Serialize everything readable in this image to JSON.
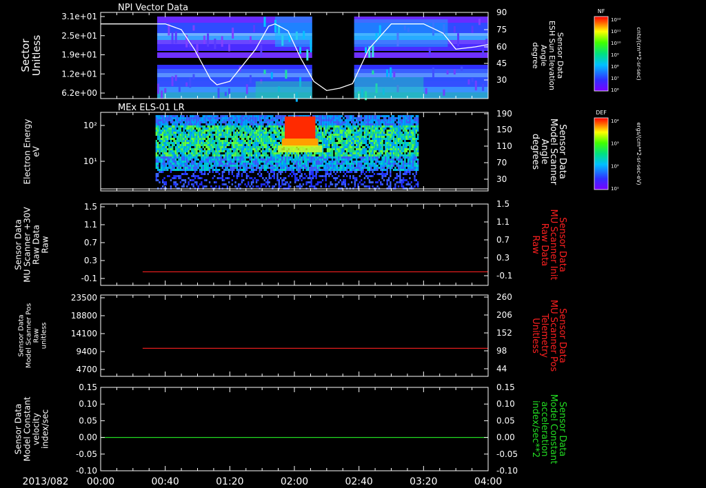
{
  "time_axis": {
    "date": "2013/082",
    "ticks": [
      "00:00",
      "00:40",
      "01:20",
      "02:00",
      "02:40",
      "03:20",
      "04:00"
    ],
    "range_minutes": [
      0,
      240
    ]
  },
  "panels": [
    {
      "id": "npi",
      "title": "NPI Vector Data",
      "left_axis_label": [
        "Sector",
        "Unitless"
      ],
      "left_ticks": [
        "3.1e+01",
        "2.5e+01",
        "1.9e+01",
        "1.2e+01",
        "6.2e+00"
      ],
      "right_axis_label": [
        "Sensor Data",
        "ESH Sun Elevation",
        "Angle",
        "degree"
      ],
      "right_ticks": [
        "90",
        "75",
        "60",
        "45",
        "30"
      ],
      "colorbar": {
        "title": "NF",
        "unit": "cnts/(cm**2-sr-sec)",
        "labels": [
          "10¹²",
          "10¹¹",
          "10¹⁰",
          "10⁹",
          "10⁸",
          "10⁷",
          "10⁶"
        ]
      }
    },
    {
      "id": "els",
      "title": "MEx ELS-01 LR",
      "left_axis_label": [
        "Electron Energy",
        "eV"
      ],
      "left_ticks": [
        "10²",
        "10¹"
      ],
      "right_axis_label": [
        "Sensor Data",
        "Model Scanner",
        "Angle",
        "degrees"
      ],
      "right_ticks": [
        "190",
        "150",
        "110",
        "70",
        "30"
      ],
      "colorbar": {
        "title": "DEF",
        "unit": "ergs/(cm**2-sr-sec-eV)",
        "labels": [
          "10⁴",
          "10³",
          "10²",
          "10¹"
        ]
      }
    },
    {
      "id": "scanner_raw",
      "left_axis_label": [
        "Sensor Data",
        "MU Scanner +30V",
        "Raw Data",
        "Raw"
      ],
      "left_ticks": [
        "1.5",
        "1.1",
        "0.7",
        "0.3",
        "-0.1"
      ],
      "right_axis_label": [
        "Sensor Data",
        "MU Scanner Init",
        "Raw Data",
        "Raw"
      ],
      "right_ticks": [
        "1.5",
        "1.1",
        "0.7",
        "0.3",
        "-0.1"
      ],
      "right_label_color": "#ff2020"
    },
    {
      "id": "scanner_pos",
      "left_axis_label": [
        "Sensor Data",
        "Model Scanner Pos",
        "Raw",
        "unitless"
      ],
      "left_ticks": [
        "23500",
        "18800",
        "14100",
        "9400",
        "4700"
      ],
      "right_axis_label": [
        "Sensor Data",
        "MU Scanner Pos",
        "Telemetry",
        "Unitless"
      ],
      "right_ticks": [
        "260",
        "206",
        "152",
        "98",
        "44"
      ],
      "right_label_color": "#ff2020"
    },
    {
      "id": "model_const",
      "left_axis_label": [
        "Sensor Data",
        "Model Constant",
        "velocity",
        "index/sec"
      ],
      "left_ticks": [
        "0.15",
        "0.10",
        "0.05",
        "0.00",
        "-0.05",
        "-0.10"
      ],
      "right_axis_label": [
        "Sensor Data",
        "Model Constant",
        "acceleration",
        "index/sec**2"
      ],
      "right_ticks": [
        "0.15",
        "0.10",
        "0.05",
        "0.00",
        "-0.05",
        "-0.10"
      ],
      "right_label_color": "#22dd22"
    }
  ],
  "chart_data": [
    {
      "type": "heatmap",
      "title": "NPI Vector Data",
      "ylabel": "Sector Unitless",
      "data_gap_minutes": [
        [
          0,
          35
        ],
        [
          131,
          157
        ]
      ],
      "overlay_line": {
        "name": "Sensor Data ESH Sun Elevation Angle",
        "color": "#ffffff",
        "ylim": [
          15,
          90
        ],
        "x_minutes": [
          0,
          32,
          40,
          50,
          58,
          68,
          72,
          80,
          96,
          104,
          108,
          116,
          124,
          132,
          140,
          148,
          156,
          166,
          180,
          192,
          200,
          212,
          220,
          232,
          240
        ],
        "y": [
          80,
          80,
          80,
          75,
          58,
          32,
          27,
          30,
          58,
          78,
          80,
          74,
          50,
          30,
          22,
          24,
          28,
          58,
          80,
          80,
          80,
          72,
          58,
          60,
          62
        ]
      }
    },
    {
      "type": "heatmap",
      "title": "MEx ELS-01 LR",
      "ylabel": "Electron Energy eV",
      "x_coverage_minutes": [
        34,
        197
      ],
      "hot_region_minutes": [
        114,
        133
      ],
      "overlay_line": {
        "name": "Sensor Data Model Scanner Angle",
        "color": "#ffffff",
        "ylim": [
          0,
          190
        ],
        "x_minutes": [
          0,
          240
        ],
        "y": [
          5,
          5
        ]
      }
    },
    {
      "type": "line",
      "series": [
        {
          "name": "Sensor Data MU Scanner Init Raw Data",
          "color": "#ff2020",
          "x_minutes": [
            26,
            240
          ],
          "y": [
            -0.0,
            -0.0
          ]
        }
      ],
      "ylim": [
        -0.3,
        1.5
      ]
    },
    {
      "type": "line",
      "series": [
        {
          "name": "Sensor Data MU Scanner Pos Telemetry",
          "color": "#ff2020",
          "x_minutes": [
            26,
            240
          ],
          "y": [
            8100,
            8100
          ]
        }
      ],
      "ylim": [
        0,
        23500
      ]
    },
    {
      "type": "line",
      "series": [
        {
          "name": "Sensor Data Model Constant acceleration",
          "color": "#22dd22",
          "x_minutes": [
            0,
            240
          ],
          "y": [
            0.0,
            0.0
          ]
        }
      ],
      "ylim": [
        -0.1,
        0.15
      ]
    }
  ]
}
